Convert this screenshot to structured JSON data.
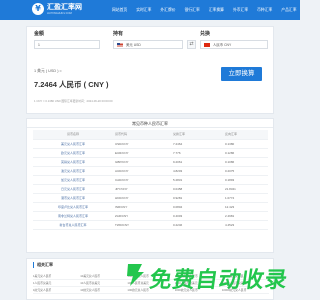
{
  "header": {
    "logo_mark": "¥",
    "logo_cn": "汇盈汇率网",
    "logo_en": "HUIYINGHUILV.COM",
    "nav": [
      "网站首页",
      "实时汇率",
      "外汇牌价",
      "银行汇率",
      "汇率换算",
      "外币汇率",
      "币种汇率",
      "产品汇率"
    ],
    "accent_color": "#1f7ad8"
  },
  "converter": {
    "amount_label": "金额",
    "amount_value": "1",
    "from_label": "持有",
    "from_value": "美元 USD",
    "to_label": "兑换",
    "to_value": "人民币 CNY",
    "swap_icon": "⇄",
    "rate_line": "1 美元 ( USD ) =",
    "result": "7.2464 人民币 ( CNY )",
    "info_line": "1 CNY = 0.1380 USD  国际汇率更新时间：2024-06-20 00:00:00",
    "convert_button": "立即换算"
  },
  "rates_table": {
    "title": "常见币种人民币汇率",
    "headers": [
      "货币名称",
      "货币代码",
      "兑换汇率",
      "反向汇率"
    ],
    "rows": [
      [
        "美元兑人民币汇率",
        "USD/CNY",
        "7.2464",
        "0.1380"
      ],
      [
        "欧元兑人民币汇率",
        "EUR/CNY",
        "7.776",
        "0.1286"
      ],
      [
        "英镑兑人民币汇率",
        "GBP/CNY",
        "9.2061",
        "0.1086"
      ],
      [
        "澳元兑人民币汇率",
        "AUD/CNY",
        "4.8203",
        "0.2075"
      ],
      [
        "加元兑人民币汇率",
        "CAD/CNY",
        "5.2831",
        "0.1893"
      ],
      [
        "日元兑人民币汇率",
        "JPY/CNY",
        "0.0458",
        "21.8341"
      ],
      [
        "港币兑人民币汇率",
        "HKD/CNY",
        "0.9281",
        "1.0774"
      ],
      [
        "印度卢比兑人民币汇率",
        "INR/CNY",
        "0.0804",
        "12.423"
      ],
      [
        "南非兰特兑人民币汇率",
        "ZAR/CNY",
        "0.4003",
        "2.4981"
      ],
      [
        "新台币兑人民币汇率",
        "TWD/CNY",
        "0.2246",
        "4.4523"
      ]
    ]
  },
  "bottom": {
    "title": "相关汇率",
    "links": [
      [
        "1美元兑人民币",
        "10美元兑人民币",
        "100美元兑人民币",
        "1000美元兑人民币",
        "10000美元兑人民币"
      ],
      [
        "1人民币兑美元",
        "10人民币兑美元",
        "100人民币兑美元",
        "1000人民币兑美元",
        "10000人民币兑美元"
      ],
      [
        "1欧元兑人民币",
        "10欧元兑人民币",
        "100欧元兑人民币",
        "1000欧元兑人民币",
        "10000欧元兑人民币"
      ]
    ]
  },
  "watermark": {
    "text": "免费自动收录",
    "color": "#23c64d"
  }
}
